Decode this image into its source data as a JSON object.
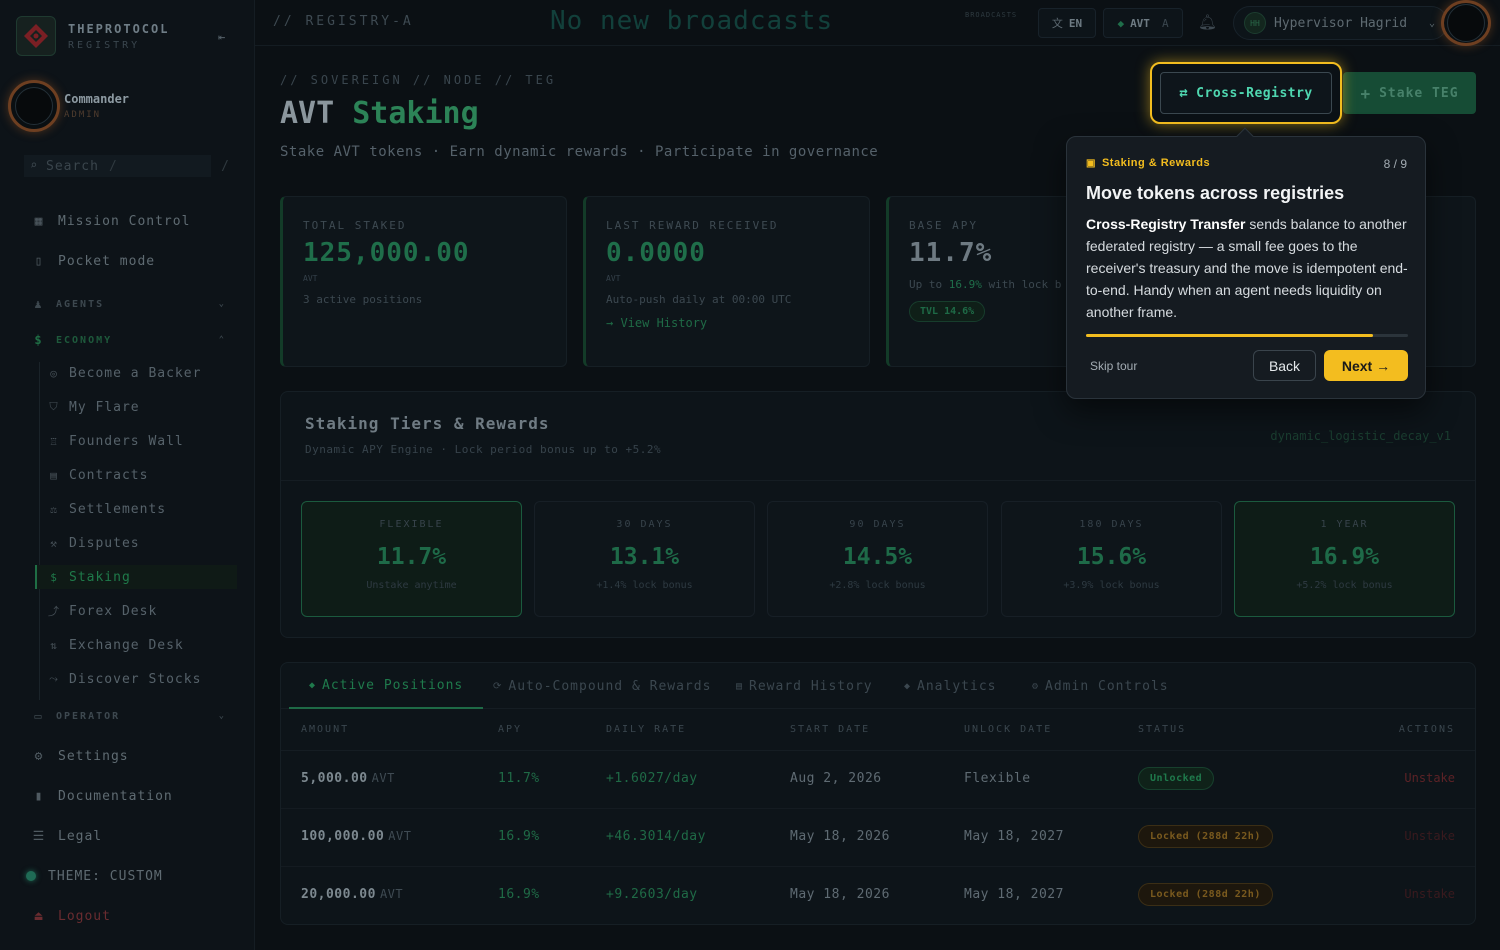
{
  "brand": {
    "name": "THEPROTOCOL",
    "sub": "REGISTRY",
    "accent": "#2c8357",
    "tour_accent": "#f3bd1f"
  },
  "user": {
    "name": "Commander",
    "role": "ADMIN"
  },
  "search": {
    "placeholder": "Search",
    "shortcut": "/"
  },
  "nav": {
    "top": [
      {
        "label": "Mission Control",
        "icon": "grid-icon"
      },
      {
        "label": "Pocket mode",
        "icon": "phone-icon"
      }
    ],
    "sections": {
      "agents": "AGENTS",
      "economy": "ECONOMY",
      "operator": "OPERATOR"
    },
    "economy_items": [
      {
        "label": "Become a Backer",
        "icon": "coins-icon"
      },
      {
        "label": "My Flare",
        "icon": "shield-icon"
      },
      {
        "label": "Founders Wall",
        "icon": "trophy-icon"
      },
      {
        "label": "Contracts",
        "icon": "document-icon"
      },
      {
        "label": "Settlements",
        "icon": "scale-icon"
      },
      {
        "label": "Disputes",
        "icon": "gavel-icon"
      },
      {
        "label": "Staking",
        "icon": "dollar-icon"
      },
      {
        "label": "Forex Desk",
        "icon": "trend-icon"
      },
      {
        "label": "Exchange Desk",
        "icon": "exchange-icon"
      },
      {
        "label": "Discover Stocks",
        "icon": "chart-icon"
      }
    ],
    "bottom": [
      {
        "label": "Settings",
        "icon": "gear-icon"
      },
      {
        "label": "Documentation",
        "icon": "book-icon"
      },
      {
        "label": "Legal",
        "icon": "legal-icon"
      },
      {
        "label": "THEME: CUSTOM",
        "icon": "theme-dot-icon"
      },
      {
        "label": "Logout",
        "icon": "logout-icon"
      }
    ]
  },
  "topbar": {
    "registry": "// REGISTRY-A",
    "broadcast": "No new broadcasts",
    "broadcast_tag": "BROADCASTS",
    "lang": "EN",
    "currency": "AVT",
    "currency_suffix": "A",
    "user": "Hypervisor Hagrid",
    "user_initials": "HH"
  },
  "page": {
    "crumb": "// SOVEREIGN // NODE // TEG",
    "title_a": "AVT",
    "title_b": "Staking",
    "subtitle": "Stake AVT tokens · Earn dynamic rewards · Participate in governance",
    "stake_button": "Stake TEG",
    "cross_registry_button": "Cross-Registry"
  },
  "stats": {
    "total_staked": {
      "label": "TOTAL STAKED",
      "value": "125,000.00",
      "unit": "AVT",
      "note": "3 active positions"
    },
    "last_reward": {
      "label": "LAST REWARD RECEIVED",
      "value": "0.0000",
      "unit": "AVT",
      "note": "Auto-push daily at 00:00 UTC",
      "link": "→ View History"
    },
    "base_apy": {
      "label": "BASE APY",
      "value": "11.7%",
      "note_a": "Up to",
      "note_b": "16.9%",
      "note_c": "with lock b",
      "badge": "TVL 14.6%"
    }
  },
  "tiers": {
    "title": "Staking Tiers & Rewards",
    "subtitle": "Dynamic APY Engine · Lock period bonus up to +5.2%",
    "engine": "dynamic_logistic_decay_v1",
    "items": [
      {
        "name": "FLEXIBLE",
        "apy": "11.7%",
        "note": "Unstake anytime"
      },
      {
        "name": "30 DAYS",
        "apy": "13.1%",
        "note": "+1.4% lock bonus"
      },
      {
        "name": "90 DAYS",
        "apy": "14.5%",
        "note": "+2.8% lock bonus"
      },
      {
        "name": "180 DAYS",
        "apy": "15.6%",
        "note": "+3.9% lock bonus"
      },
      {
        "name": "1 YEAR",
        "apy": "16.9%",
        "note": "+5.2% lock bonus"
      }
    ]
  },
  "positions": {
    "tabs": [
      {
        "label": "Active Positions",
        "icon": "◆"
      },
      {
        "label": "Auto-Compound & Rewards",
        "icon": "⟳"
      },
      {
        "label": "Reward History",
        "icon": "▤"
      },
      {
        "label": "Analytics",
        "icon": "◆"
      },
      {
        "label": "Admin Controls",
        "icon": "⚙"
      }
    ],
    "columns": [
      "AMOUNT",
      "APY",
      "DAILY RATE",
      "START DATE",
      "UNLOCK DATE",
      "STATUS",
      "ACTIONS"
    ],
    "rows": [
      {
        "amount": "5,000.00",
        "unit": "AVT",
        "apy": "11.7%",
        "rate": "+1.6027/day",
        "start": "Aug 2, 2026",
        "unlock": "Flexible",
        "status": "Unlocked",
        "action": "Unstake"
      },
      {
        "amount": "100,000.00",
        "unit": "AVT",
        "apy": "16.9%",
        "rate": "+46.3014/day",
        "start": "May 18, 2026",
        "unlock": "May 18, 2027",
        "status": "Locked (288d 22h)",
        "action": "Unstake"
      },
      {
        "amount": "20,000.00",
        "unit": "AVT",
        "apy": "16.9%",
        "rate": "+9.2603/day",
        "start": "May 18, 2026",
        "unlock": "May 18, 2027",
        "status": "Locked (288d 22h)",
        "action": "Unstake"
      }
    ]
  },
  "tour": {
    "category": "Staking & Rewards",
    "step": "8 / 9",
    "progress": 0.89,
    "title": "Move tokens across registries",
    "body_bold": "Cross-Registry Transfer",
    "body_rest": " sends balance to another federated registry — a small fee goes to the receiver's treasury and the move is idempotent end-to-end. Handy when an agent needs liquidity on another frame.",
    "skip": "Skip tour",
    "back": "Back",
    "next": "Next →"
  }
}
